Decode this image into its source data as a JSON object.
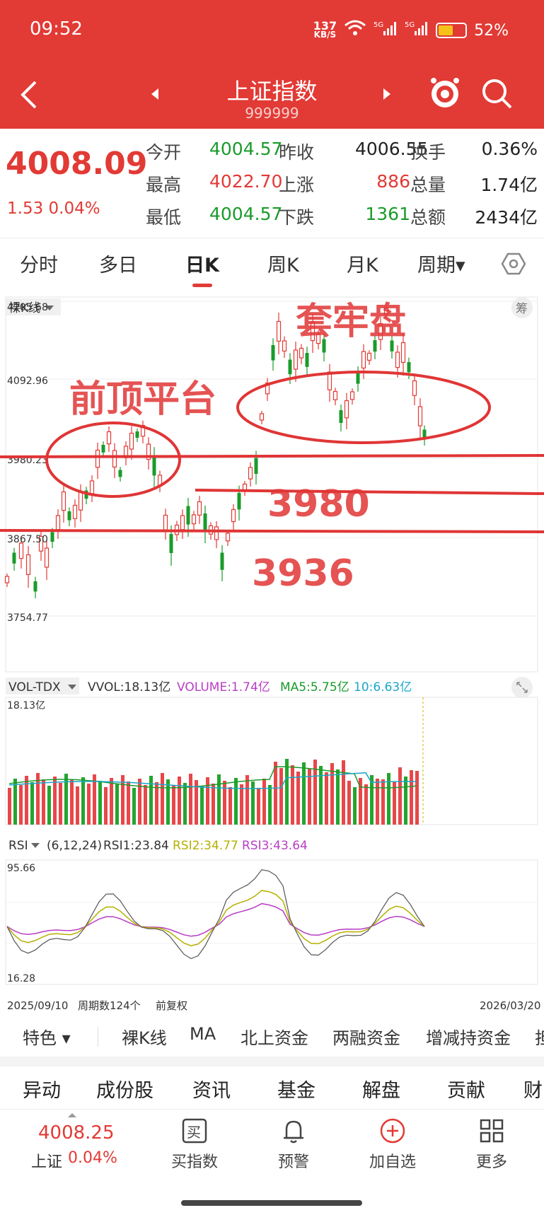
{
  "status": {
    "time": "09:52",
    "speed": "137",
    "speed_unit": "KB/S",
    "battery": "52%"
  },
  "header": {
    "title": "上证指数",
    "code": "999999"
  },
  "quote": {
    "price": "4008.09",
    "change": "1.53 0.04%",
    "rows": [
      [
        {
          "label": "今开",
          "value": "4004.57",
          "color": "green"
        },
        {
          "label": "昨收",
          "value": "4006.55",
          "color": "black"
        },
        {
          "label": "换手",
          "value": "0.36%",
          "color": "black"
        }
      ],
      [
        {
          "label": "最高",
          "value": "4022.70",
          "color": "red"
        },
        {
          "label": "上涨",
          "value": "886",
          "color": "red"
        },
        {
          "label": "总量",
          "value": "1.74亿",
          "color": "black"
        }
      ],
      [
        {
          "label": "最低",
          "value": "4004.57",
          "color": "green"
        },
        {
          "label": "下跌",
          "value": "1361",
          "color": "green"
        },
        {
          "label": "总额",
          "value": "2434亿",
          "color": "black"
        }
      ]
    ]
  },
  "period_tabs": [
    "分时",
    "多日",
    "日K",
    "周K",
    "月K",
    "周期▾"
  ],
  "active_tab": "日K",
  "kline": {
    "type_label": "裸K线",
    "badge": "筹",
    "y_labels": [
      "4205.68",
      "4092.96",
      "3980.23",
      "3867.50",
      "3754.77"
    ],
    "annotations": {
      "top_platform": "前顶平台",
      "trap": "套牢盘",
      "level_1": "3980",
      "level_2": "3936"
    }
  },
  "volume": {
    "indicator": "VOL-TDX",
    "vvol": "VVOL:18.13亿",
    "volume": "VOLUME:1.74亿",
    "ma5": "MA5:5.75亿",
    "ma10": "10:6.63亿",
    "top_label": "18.13亿"
  },
  "rsi": {
    "indicator": "RSI",
    "params": "(6,12,24)",
    "rsi1": "RSI1:23.84",
    "rsi2": "RSI2:34.77",
    "rsi3": "RSI3:43.64",
    "top_label": "95.66",
    "bottom_label": "16.28",
    "start_date": "2025/09/10",
    "period_count": "周期数124个",
    "adjust": "前复权",
    "end_date": "2026/03/20"
  },
  "toolbar": [
    "特色 ▾",
    "裸K线",
    "MA",
    "北上资金",
    "两融资金",
    "增减持资金",
    "担"
  ],
  "bottom_tabs": [
    "异动",
    "成份股",
    "资讯",
    "基金",
    "解盘",
    "贡献",
    "财"
  ],
  "dock": {
    "index_price": "4008.25",
    "index_name": "上证",
    "index_change": "0.04%",
    "buttons": [
      {
        "label": "买指数",
        "icon": "buy-icon"
      },
      {
        "label": "预警",
        "icon": "bell-icon"
      },
      {
        "label": "加自选",
        "icon": "plus-circle-icon"
      },
      {
        "label": "更多",
        "icon": "grid-icon"
      }
    ]
  },
  "colors": {
    "brand_red": "#e23a35",
    "up": "#e23a35",
    "down": "#1a9b2b"
  }
}
